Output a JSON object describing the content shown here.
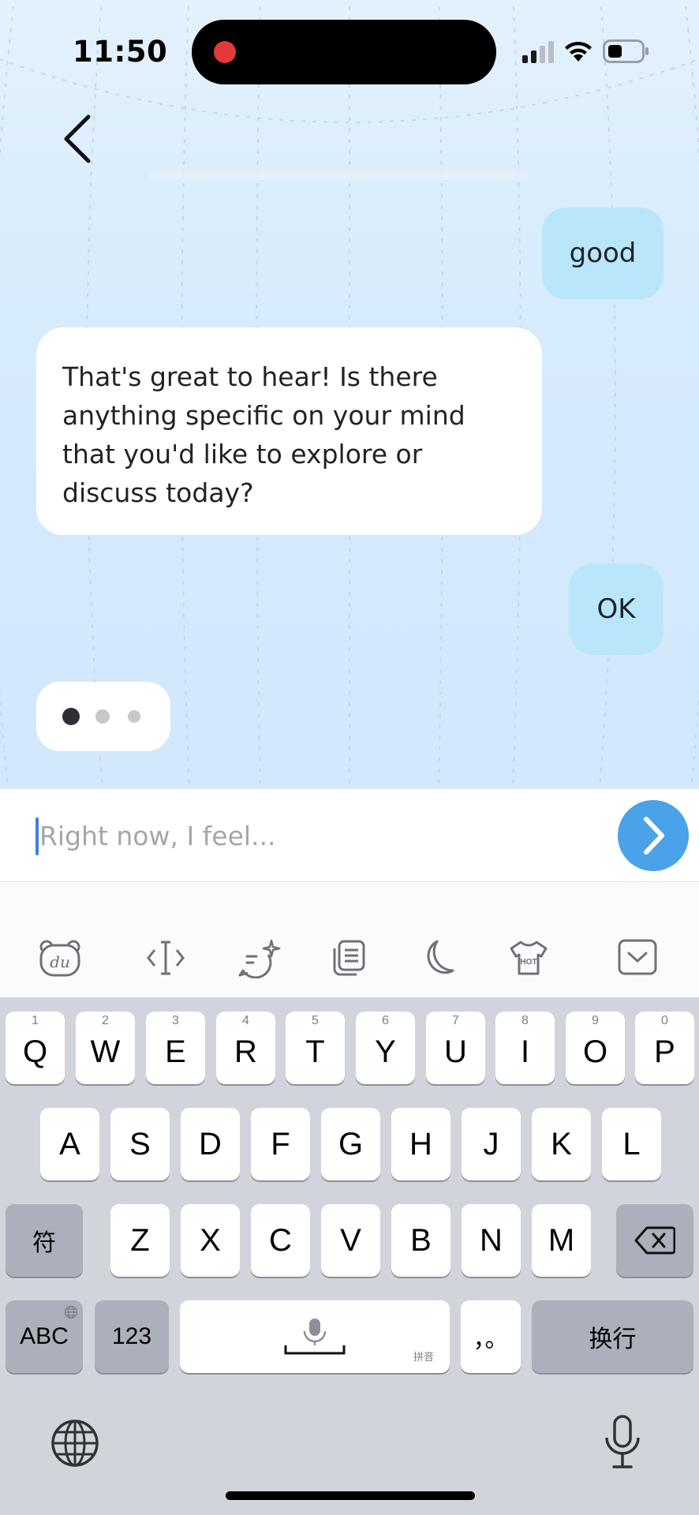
{
  "status_bar": {
    "time": "11:50"
  },
  "nav": {
    "back_label": "Back"
  },
  "messages": [
    {
      "role": "user",
      "text": "good"
    },
    {
      "role": "bot",
      "text": "That's great to hear! Is there anything specific on your mind that you'd like to explore or discuss today?"
    },
    {
      "role": "user",
      "text": "OK"
    }
  ],
  "typing_indicator": {
    "dots": 3
  },
  "composer": {
    "placeholder": "Right now, I feel..."
  },
  "keyboard": {
    "toolbar_icons": [
      "du-bear-icon",
      "cursor-move-icon",
      "ai-chat-icon",
      "clipboard-icon",
      "moon-icon",
      "hot-shirt-icon",
      "collapse-keyboard-icon"
    ],
    "hot_label": "HOT",
    "du_label": "du",
    "row1": [
      {
        "key": "Q",
        "num": "1"
      },
      {
        "key": "W",
        "num": "2"
      },
      {
        "key": "E",
        "num": "3"
      },
      {
        "key": "R",
        "num": "4"
      },
      {
        "key": "T",
        "num": "5"
      },
      {
        "key": "Y",
        "num": "6"
      },
      {
        "key": "U",
        "num": "7"
      },
      {
        "key": "I",
        "num": "8"
      },
      {
        "key": "O",
        "num": "9"
      },
      {
        "key": "P",
        "num": "0"
      }
    ],
    "row2": [
      "A",
      "S",
      "D",
      "F",
      "G",
      "H",
      "J",
      "K",
      "L"
    ],
    "row3": [
      "Z",
      "X",
      "C",
      "V",
      "B",
      "N",
      "M"
    ],
    "symbol_key": "符",
    "abc_key": "ABC",
    "num_key": "123",
    "space_hint": "拼音",
    "punct_key": "，。",
    "return_key": "换行"
  }
}
